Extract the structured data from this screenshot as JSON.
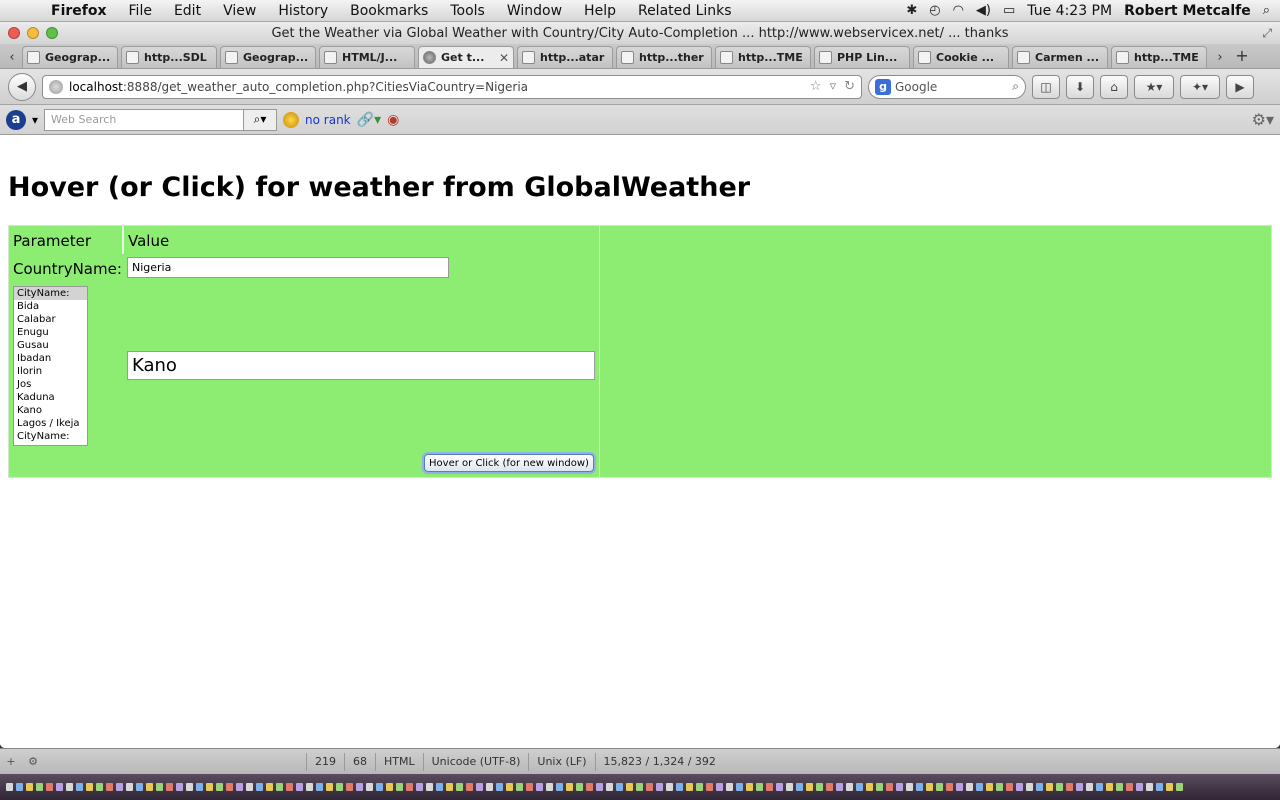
{
  "menubar": {
    "app": "Firefox",
    "items": [
      "File",
      "Edit",
      "View",
      "History",
      "Bookmarks",
      "Tools",
      "Window",
      "Help",
      "Related Links"
    ],
    "clock": "Tue 4:23 PM",
    "user": "Robert Metcalfe"
  },
  "window": {
    "title": "Get the Weather via Global Weather with Country/City Auto-Completion ... http://www.webservicex.net/ ... thanks"
  },
  "tabs": [
    {
      "label": "Geograp...",
      "active": false
    },
    {
      "label": "http...SDL",
      "active": false
    },
    {
      "label": "Geograp...",
      "active": false
    },
    {
      "label": "HTML/J...",
      "active": false
    },
    {
      "label": "Get t...",
      "active": true
    },
    {
      "label": "http...atar",
      "active": false
    },
    {
      "label": "http...ther",
      "active": false
    },
    {
      "label": "http...TME",
      "active": false
    },
    {
      "label": "PHP Lin...",
      "active": false
    },
    {
      "label": "Cookie ...",
      "active": false
    },
    {
      "label": "Carmen ...",
      "active": false
    },
    {
      "label": "http...TME",
      "active": false
    }
  ],
  "navbar": {
    "url_host": "localhost",
    "url_rest": ":8888/get_weather_auto_completion.php?CitiesViaCountry=Nigeria",
    "search_engine": "Google"
  },
  "addonbar": {
    "websearch_placeholder": "Web Search",
    "rank_label": "no rank"
  },
  "page": {
    "title": "Hover (or Click) for weather from GlobalWeather",
    "col_parameter": "Parameter",
    "col_value": "Value",
    "country_label": "CountryName:",
    "country_value": "Nigeria",
    "cities": [
      "CityName:",
      "Bida",
      "Calabar",
      "Enugu",
      "Gusau",
      "Ibadan",
      "Ilorin",
      "Jos",
      "Kaduna",
      "Kano",
      "Lagos / Ikeja",
      "CityName:"
    ],
    "selected_city_index": 0,
    "city_value": "Kano",
    "button_label": "Hover or Click (for new window)"
  },
  "statusbar": {
    "line": "219",
    "col": "68",
    "syntax": "HTML",
    "encoding": "Unicode (UTF-8)",
    "line_endings": "Unix (LF)",
    "stats": "15,823 / 1,324 / 392"
  },
  "colors": {
    "panel_green": "#8ced72"
  }
}
